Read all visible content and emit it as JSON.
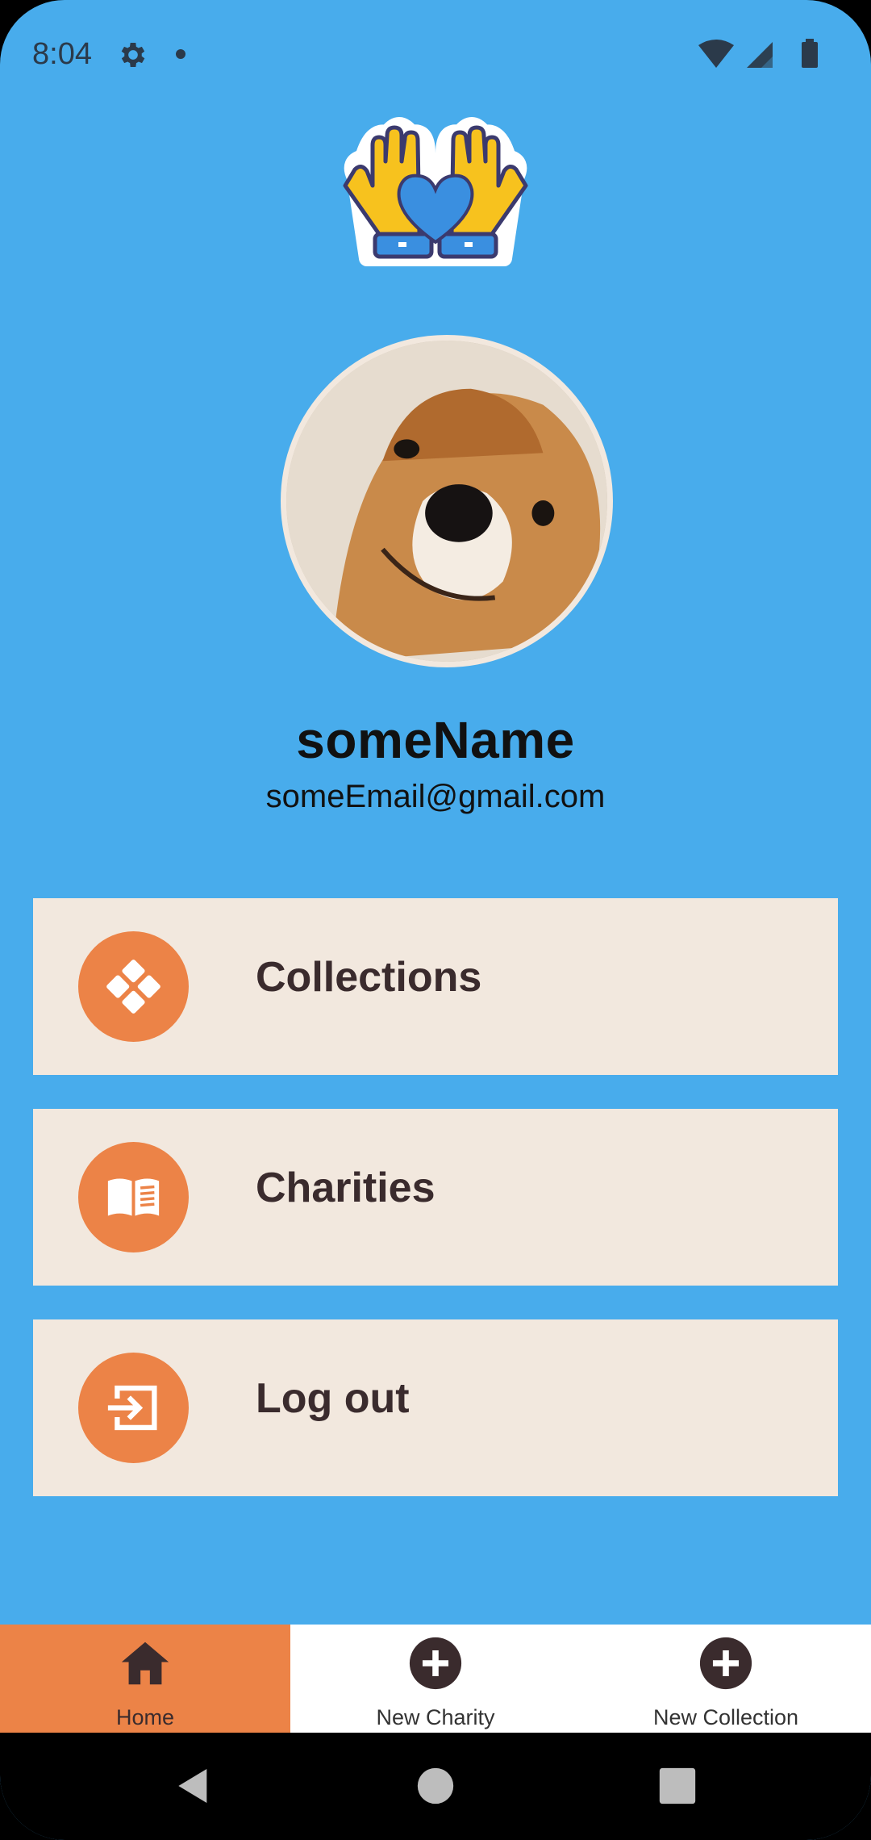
{
  "status_bar": {
    "time": "8:04",
    "icons": [
      "gear-icon",
      "notification-dot",
      "wifi-icon",
      "signal-icon",
      "battery-icon"
    ]
  },
  "app": {
    "logo_icon": "hands-heart-logo",
    "background_color": "#48ACEC",
    "accent_color": "#EC8347",
    "card_color": "#F2E8DE"
  },
  "profile": {
    "avatar_icon": "dog-photo-avatar",
    "name": "someName",
    "email": "someEmail@gmail.com"
  },
  "menu": [
    {
      "label": "Collections",
      "icon": "grid-diamond-icon"
    },
    {
      "label": "Charities",
      "icon": "book-icon"
    },
    {
      "label": "Log out",
      "icon": "logout-icon"
    }
  ],
  "bottom_nav": [
    {
      "label": "Home",
      "icon": "home-icon",
      "selected": true
    },
    {
      "label": "New Charity",
      "icon": "add-circle-icon",
      "selected": false
    },
    {
      "label": "New Collection",
      "icon": "add-circle-icon",
      "selected": false
    }
  ],
  "system_nav": [
    "back-icon",
    "home-circle-icon",
    "recents-icon"
  ]
}
